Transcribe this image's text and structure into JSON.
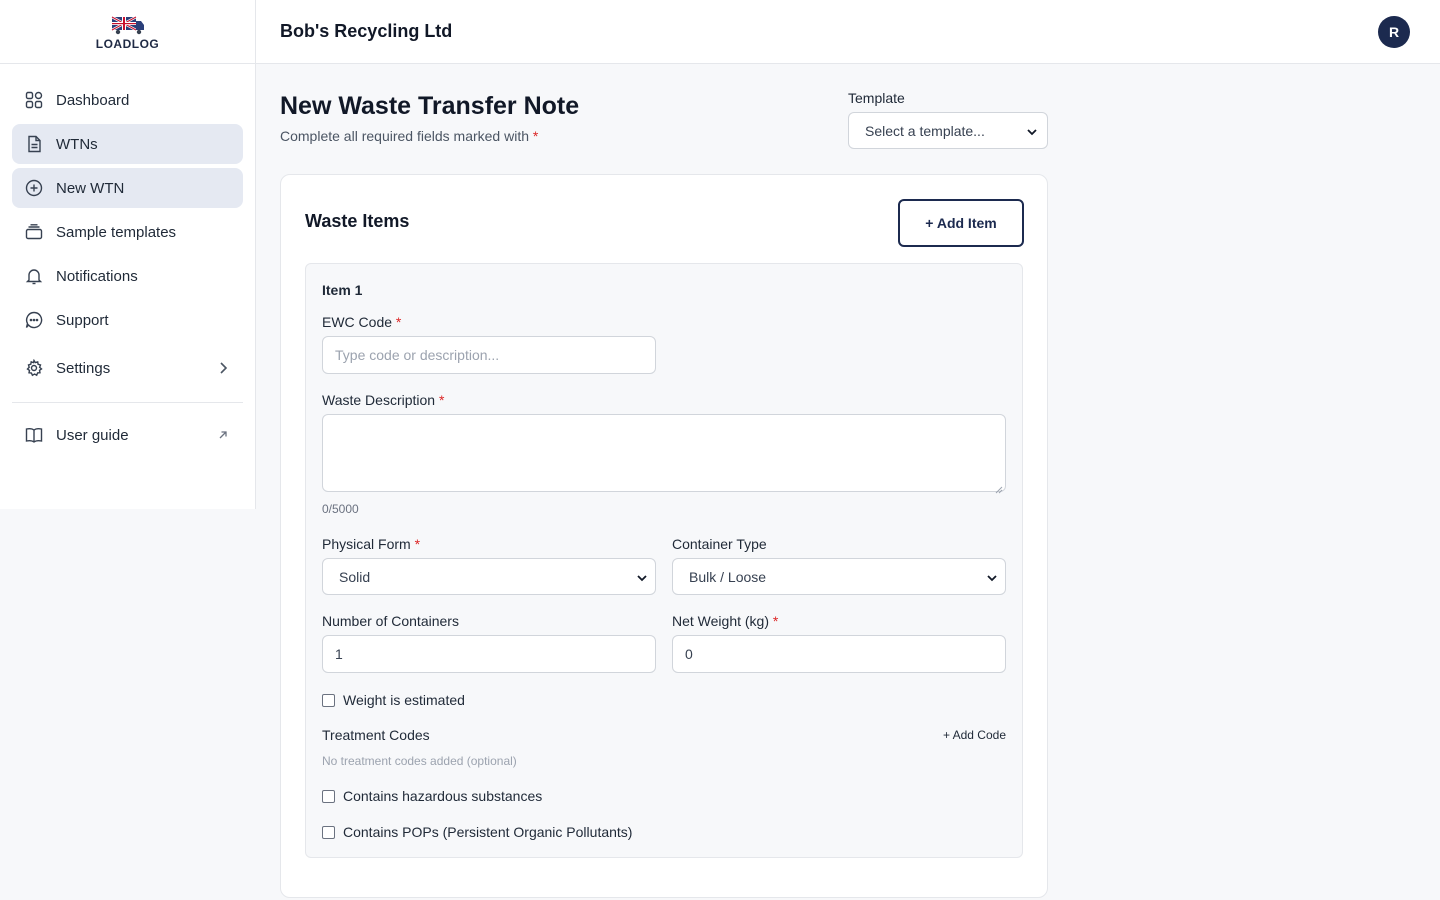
{
  "brand": {
    "logo_text": "LOADLOG"
  },
  "header": {
    "company": "Bob's Recycling Ltd",
    "avatar_initial": "R"
  },
  "sidebar": {
    "items": [
      {
        "label": "Dashboard",
        "icon": "grid-icon"
      },
      {
        "label": "WTNs",
        "icon": "document-icon"
      },
      {
        "label": "New WTN",
        "icon": "plus-circle-icon"
      },
      {
        "label": "Sample templates",
        "icon": "stack-icon"
      },
      {
        "label": "Notifications",
        "icon": "bell-icon"
      },
      {
        "label": "Support",
        "icon": "chat-icon"
      },
      {
        "label": "Settings",
        "icon": "gear-icon"
      }
    ],
    "footer_items": [
      {
        "label": "User guide",
        "icon": "book-icon"
      }
    ]
  },
  "page": {
    "title": "New Waste Transfer Note",
    "subtitle": "Complete all required fields marked with",
    "required_marker": "*",
    "template": {
      "label": "Template",
      "selected": "Select a template..."
    }
  },
  "card": {
    "title": "Waste Items",
    "add_item_label": "+ Add Item",
    "item": {
      "title": "Item 1",
      "ewc_code": {
        "label": "EWC Code",
        "placeholder": "Type code or description...",
        "value": ""
      },
      "waste_description": {
        "label": "Waste Description",
        "value": "",
        "counter": "0/5000"
      },
      "physical_form": {
        "label": "Physical Form",
        "selected": "Solid"
      },
      "container_type": {
        "label": "Container Type",
        "selected": "Bulk / Loose"
      },
      "num_containers": {
        "label": "Number of Containers",
        "value": "1"
      },
      "net_weight": {
        "label": "Net Weight (kg)",
        "value": "0"
      },
      "weight_estimated": {
        "label": "Weight is estimated",
        "checked": false
      },
      "treatment_codes": {
        "label": "Treatment Codes",
        "add_label": "+ Add Code",
        "empty_hint": "No treatment codes added (optional)"
      },
      "hazardous": {
        "label": "Contains hazardous substances",
        "checked": false
      },
      "pops": {
        "label": "Contains POPs (Persistent Organic Pollutants)",
        "checked": false
      }
    }
  },
  "colors": {
    "accent": "#1c2a4f",
    "active_nav_bg": "#e5e9f2",
    "required": "#dc2626"
  }
}
